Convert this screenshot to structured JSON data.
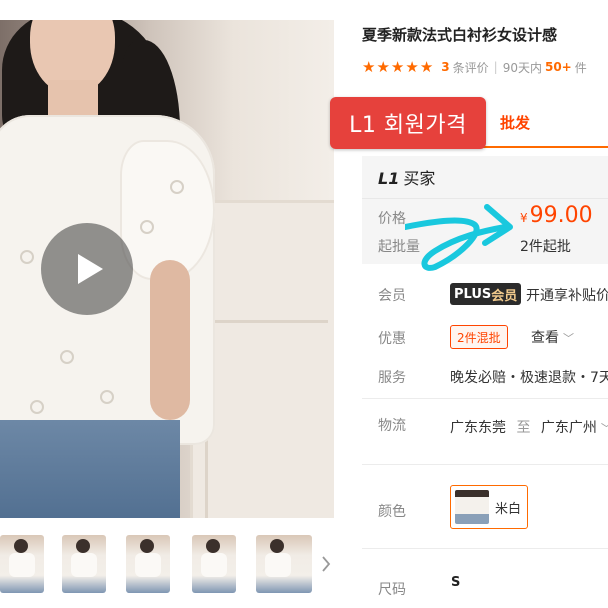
{
  "product": {
    "title": "夏季新款法式白衬衫女设计感",
    "rating": {
      "reviews_count": "3",
      "reviews_suffix": "条评价",
      "sales_prefix": "90天内",
      "sales_value": "50+",
      "sales_suffix": "件"
    }
  },
  "tabs": {
    "member_price_label": "L1 회원가격",
    "wholesale_label": "批发"
  },
  "price_panel": {
    "buyer_level": "L1",
    "buyer_label": "买家",
    "price_label": "价格",
    "currency": "¥",
    "price": "99.00",
    "moq_label": "起批量",
    "moq_value": "2件起批"
  },
  "details": {
    "member_label": "会员",
    "plus_left": "PLUS",
    "plus_right": "会员",
    "plus_desc": "开通享补贴价",
    "promo_label": "优惠",
    "promo_tag": "2件混批",
    "promo_view": "查看",
    "service_label": "服务",
    "service_text": "晚发必赔・极速退款・7天",
    "logistics_label": "物流",
    "logistics_from": "广东东莞",
    "logistics_to_word": "至",
    "logistics_to": "广东广州",
    "color_label": "颜色",
    "color_option": "米白",
    "size_label": "尺码",
    "size_value": "S"
  },
  "colors": {
    "accent": "#ff6a00",
    "price_red": "#ff4400",
    "badge_red": "#e6413c",
    "annotation_cyan": "#19c8de"
  },
  "icons": {
    "play": "play-icon",
    "next": "chevron-right-icon",
    "star": "star-icon",
    "dropdown": "chevron-down-icon",
    "annotation": "hand-drawn-arrow"
  }
}
